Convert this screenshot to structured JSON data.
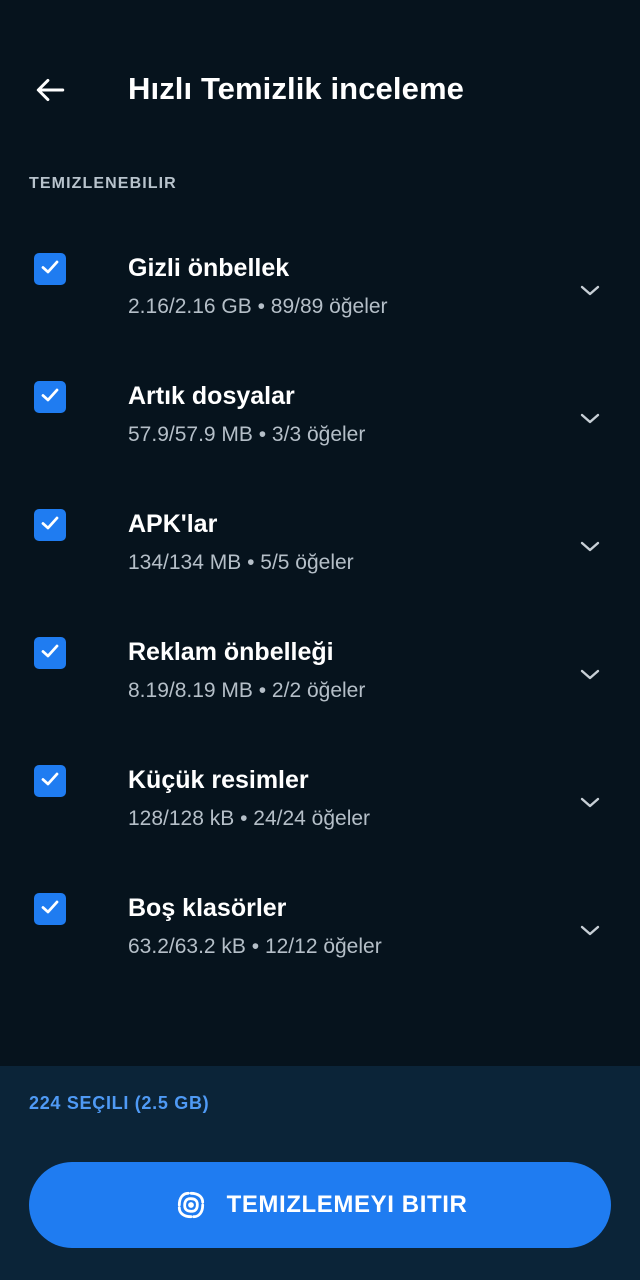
{
  "header": {
    "title": "Hızlı Temizlik inceleme",
    "back_icon": "arrow-left-icon"
  },
  "section": {
    "label": "TEMIZLENEBILIR"
  },
  "items": [
    {
      "name": "Gizli önbellek",
      "detail": "2.16/2.16 GB • 89/89 öğeler",
      "checked": true
    },
    {
      "name": "Artık dosyalar",
      "detail": "57.9/57.9 MB • 3/3 öğeler",
      "checked": true
    },
    {
      "name": "APK'lar",
      "detail": "134/134 MB • 5/5 öğeler",
      "checked": true
    },
    {
      "name": "Reklam önbelleği",
      "detail": "8.19/8.19 MB • 2/2 öğeler",
      "checked": true
    },
    {
      "name": "Küçük resimler",
      "detail": "128/128 kB • 24/24 öğeler",
      "checked": true
    },
    {
      "name": "Boş klasörler",
      "detail": "63.2/63.2 kB • 12/12 öğeler",
      "checked": true
    }
  ],
  "footer": {
    "selected_summary": "224 SEÇILI (2.5 GB)",
    "button_label": "TEMIZLEMEYI BITIR",
    "button_icon": "cleaning-swirl-icon"
  },
  "colors": {
    "background": "#06131d",
    "bottom_panel": "#0b2438",
    "accent": "#1f7cf1",
    "summary_text": "#4f9af5"
  }
}
